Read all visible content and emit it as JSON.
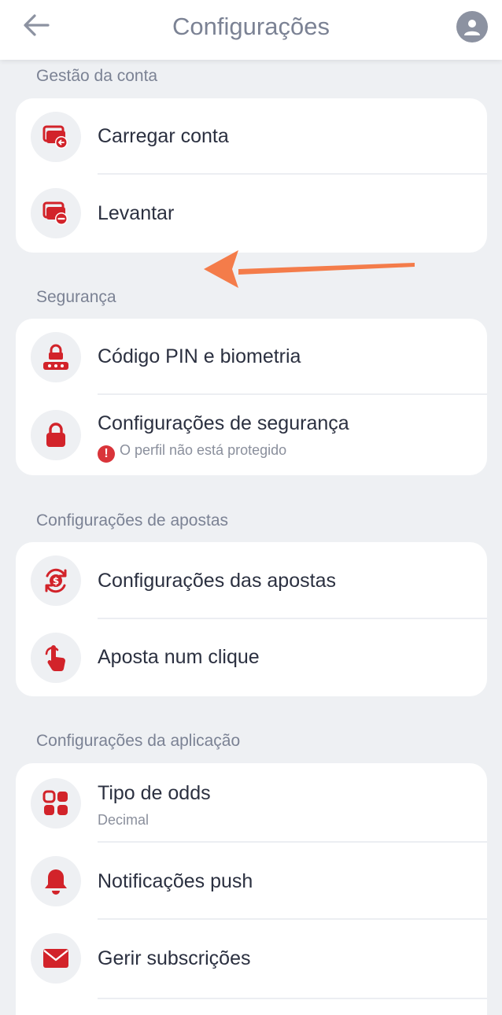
{
  "header": {
    "title": "Configurações",
    "back_icon": "arrow-left-icon",
    "profile_icon": "user-avatar-icon"
  },
  "sections": [
    {
      "title": "Gestão da conta",
      "items": [
        {
          "label": "Carregar conta",
          "icon": "wallet-deposit-icon"
        },
        {
          "label": "Levantar",
          "icon": "wallet-withdraw-icon"
        }
      ]
    },
    {
      "title": "Segurança",
      "items": [
        {
          "label": "Código PIN e biometria",
          "icon": "pin-lock-icon"
        },
        {
          "label": "Configurações de segurança",
          "sublabel": "O perfil não está protegido",
          "icon": "padlock-icon",
          "warning_icon": "alert-icon",
          "warning_color": "#d9343a"
        }
      ]
    },
    {
      "title": "Configurações de apostas",
      "items": [
        {
          "label": "Configurações das apostas",
          "icon": "bet-settings-icon"
        },
        {
          "label": "Aposta num clique",
          "icon": "one-click-tap-icon"
        }
      ]
    },
    {
      "title": "Configurações da aplicação",
      "items": [
        {
          "label": "Tipo de odds",
          "sublabel": "Decimal",
          "icon": "grid-icon"
        },
        {
          "label": "Notificações push",
          "icon": "bell-icon"
        },
        {
          "label": "Gerir subscrições",
          "icon": "envelope-icon"
        }
      ]
    }
  ],
  "colors": {
    "accent": "#d2232a",
    "annotation_arrow": "#f47c4a",
    "background": "#eef0f3"
  }
}
